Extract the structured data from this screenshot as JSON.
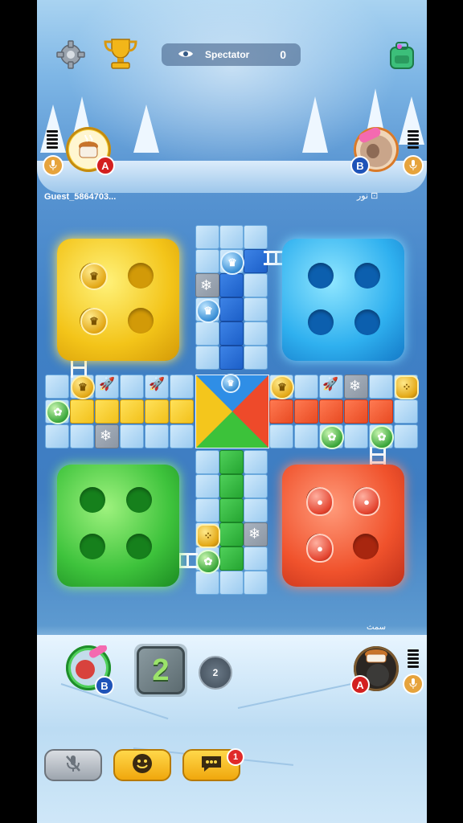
{
  "header": {
    "spectator_label": "Spectator",
    "spectator_count": "0"
  },
  "players": {
    "top_left": {
      "name": "Guest_5864703...",
      "badge": "A"
    },
    "top_right": {
      "name": "نور ⊡",
      "badge": "B"
    },
    "bottom_left": {
      "badge": "B"
    },
    "bottom_right": {
      "name": "سمث",
      "badge": "A"
    }
  },
  "dice": {
    "value": "2"
  },
  "rerolls": {
    "count": "2"
  },
  "chat": {
    "unread_count": "1"
  },
  "colors": {
    "yellow": "#f3c419",
    "blue": "#2fb0ef",
    "green": "#3ec33c",
    "red": "#f0522c"
  },
  "icons": [
    "gear-icon",
    "trophy-icon",
    "eye-icon",
    "backpack-icon",
    "microphone-icon",
    "microphone-muted-icon",
    "smiley-icon",
    "chat-bubble-icon",
    "snowflake-icon",
    "rocket-icon",
    "ladder-icon",
    "crown-icon",
    "reroll-icon"
  ]
}
